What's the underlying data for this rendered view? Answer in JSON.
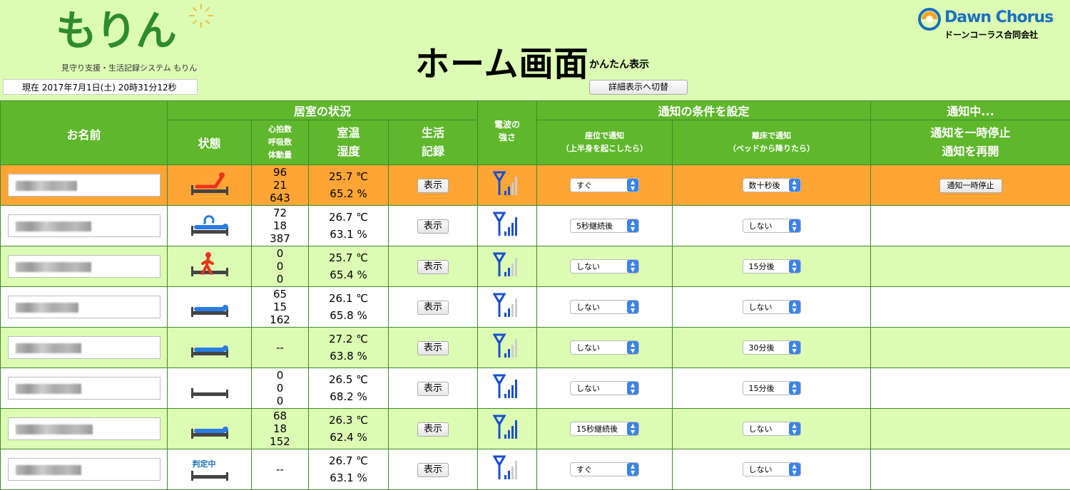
{
  "app": {
    "logo_text": "もりん",
    "logo_subtitle": "見守り支援・生活記録システム もりん",
    "title": "ホーム画面",
    "subtitle": "かんたん表示",
    "brand_name": "Dawn Chorus",
    "brand_company": "ドーンコーラス合同会社",
    "clock": "現在 2017年7月1日(土) 20時31分12秒",
    "switch_label": "詳細表示へ切替"
  },
  "table": {
    "h_name": "お名前",
    "h_room": "居室の状況",
    "h_state": "状態",
    "h_vitals1": "心拍数",
    "h_vitals2": "呼吸数",
    "h_vitals3": "体動量",
    "h_temp": "室温",
    "h_humid": "湿度",
    "h_life1": "生活",
    "h_life2": "記録",
    "h_signal1": "電波の",
    "h_signal2": "強さ",
    "h_notify": "通知の条件を設定",
    "h_sit1": "座位で通知",
    "h_sit2": "（上半身を起こしたら）",
    "h_leave1": "離床で通知",
    "h_leave2": "（ベッドから降りたら）",
    "h_active": "通知中...",
    "h_pause": "通知を一時停止",
    "h_resume": "通知を再開",
    "show_label": "表示",
    "pause_label": "通知一時停止",
    "judging": "判定中"
  },
  "rows": [
    {
      "state": "sitting-up",
      "hr": "96",
      "rr": "21",
      "mv": "643",
      "temp": "25.7 ℃",
      "humid": "65.2 %",
      "signal": 2,
      "sit": "すぐ",
      "leave": "数十秒後",
      "alert": true
    },
    {
      "state": "lying-turning",
      "hr": "72",
      "rr": "18",
      "mv": "387",
      "temp": "26.7 ℃",
      "humid": "63.1 %",
      "signal": 4,
      "sit": "5秒継続後",
      "leave": "しない"
    },
    {
      "state": "left-bed",
      "hr": "0",
      "rr": "0",
      "mv": "0",
      "temp": "25.7 ℃",
      "humid": "65.4 %",
      "signal": 2,
      "sit": "しない",
      "leave": "15分後"
    },
    {
      "state": "lying",
      "hr": "65",
      "rr": "15",
      "mv": "162",
      "temp": "26.1 ℃",
      "humid": "65.8 %",
      "signal": 2,
      "sit": "しない",
      "leave": "しない"
    },
    {
      "state": "lying",
      "dash": "--",
      "temp": "27.2 ℃",
      "humid": "63.8 %",
      "signal": 2,
      "sit": "しない",
      "leave": "30分後"
    },
    {
      "state": "empty",
      "hr": "0",
      "rr": "0",
      "mv": "0",
      "temp": "26.5 ℃",
      "humid": "68.2 %",
      "signal": 4,
      "sit": "しない",
      "leave": "15分後"
    },
    {
      "state": "lying",
      "hr": "68",
      "rr": "18",
      "mv": "152",
      "temp": "26.3 ℃",
      "humid": "62.4 %",
      "signal": 4,
      "sit": "15秒継続後",
      "leave": "しない"
    },
    {
      "state": "judging",
      "dash": "--",
      "temp": "26.7 ℃",
      "humid": "63.1 %",
      "signal": 2,
      "sit": "すぐ",
      "leave": "しない"
    }
  ]
}
